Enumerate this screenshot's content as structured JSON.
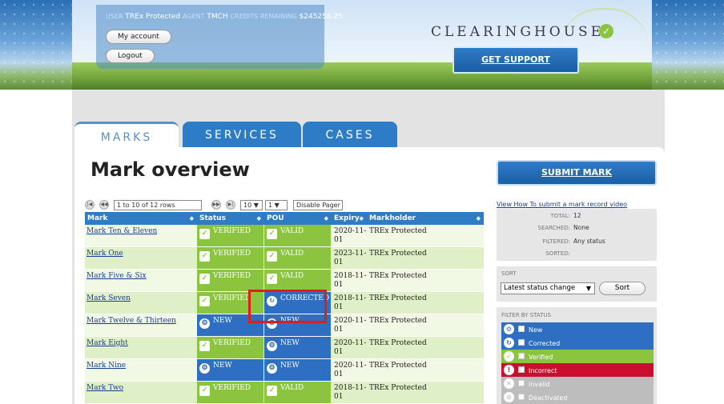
{
  "header": {
    "user_label": "USER",
    "user_value": "TREx Protected",
    "agent_label": "AGENT",
    "agent_value": "TMCH",
    "credits_label": "CREDITS REMAINING",
    "credits_value": "$245256.25",
    "my_account": "My account",
    "logout": "Logout",
    "logo": "CLEARINGHOUSE",
    "support": "GET SUPPORT"
  },
  "tabs": [
    "MARKS",
    "SERVICES",
    "CASES"
  ],
  "page_title": "Mark overview",
  "pager": {
    "rows_info": "1 to 10 of 12 rows",
    "page_size": "10",
    "page": "1",
    "disable": "Disable Pager"
  },
  "table": {
    "headers": [
      "Mark",
      "Status",
      "POU",
      "Expiry",
      "Markholder"
    ],
    "rows": [
      {
        "mark": "Mark Ten & Eleven",
        "status": "VERIFIED",
        "pou": "VALID",
        "expiry_1": "2020-11-",
        "expiry_2": "01",
        "holder": "TREx Protected"
      },
      {
        "mark": "Mark One",
        "status": "VERIFIED",
        "pou": "VALID",
        "expiry_1": "2023-11-",
        "expiry_2": "01",
        "holder": "TREx Protected"
      },
      {
        "mark": "Mark Five & Six",
        "status": "VERIFIED",
        "pou": "VALID",
        "expiry_1": "2018-11-",
        "expiry_2": "01",
        "holder": "TREx Protected"
      },
      {
        "mark": "Mark Seven",
        "status": "VERIFIED",
        "pou": "CORRECTED",
        "expiry_1": "2018-11-",
        "expiry_2": "01",
        "holder": "TREx Protected"
      },
      {
        "mark": "Mark Twelve & Thirteen",
        "status": "NEW",
        "pou": "NEW",
        "expiry_1": "2020-11-",
        "expiry_2": "01",
        "holder": "TREx Protected"
      },
      {
        "mark": "Mark Eight",
        "status": "VERIFIED",
        "pou": "NEW",
        "expiry_1": "2020-11-",
        "expiry_2": "01",
        "holder": "TREx Protected"
      },
      {
        "mark": "Mark Nine",
        "status": "NEW",
        "pou": "NEW",
        "expiry_1": "2020-11-",
        "expiry_2": "01",
        "holder": "TREx Protected"
      },
      {
        "mark": "Mark Two",
        "status": "VERIFIED",
        "pou": "VALID",
        "expiry_1": "2018-11-",
        "expiry_2": "01",
        "holder": "TREx Protected"
      }
    ]
  },
  "sidebar": {
    "submit": "SUBMIT MARK",
    "video_link": "View How To submit a mark record video",
    "stats": [
      {
        "k": "TOTAL:",
        "v": "12"
      },
      {
        "k": "SEARCHED:",
        "v": "None"
      },
      {
        "k": "FILTERED:",
        "v": "Any status"
      },
      {
        "k": "SORTED:",
        "v": ""
      }
    ],
    "sort_label": "SORT",
    "sort_value": "Latest status change",
    "sort_button": "Sort",
    "filter_label": "FILTER BY STATUS",
    "filters": [
      {
        "label": "New",
        "color": "#2f6fc2"
      },
      {
        "label": "Corrected",
        "color": "#2f6fc2"
      },
      {
        "label": "Verified",
        "color": "#8bc53f"
      },
      {
        "label": "Incorrect",
        "color": "#c8102e"
      },
      {
        "label": "Invalid",
        "color": "#bdbdbd"
      },
      {
        "label": "Deactivated",
        "color": "#bdbdbd"
      }
    ]
  },
  "colors": {
    "accent": "#2f7cc6",
    "verified": "#8bc53f",
    "highlight": "#e21b1b"
  }
}
